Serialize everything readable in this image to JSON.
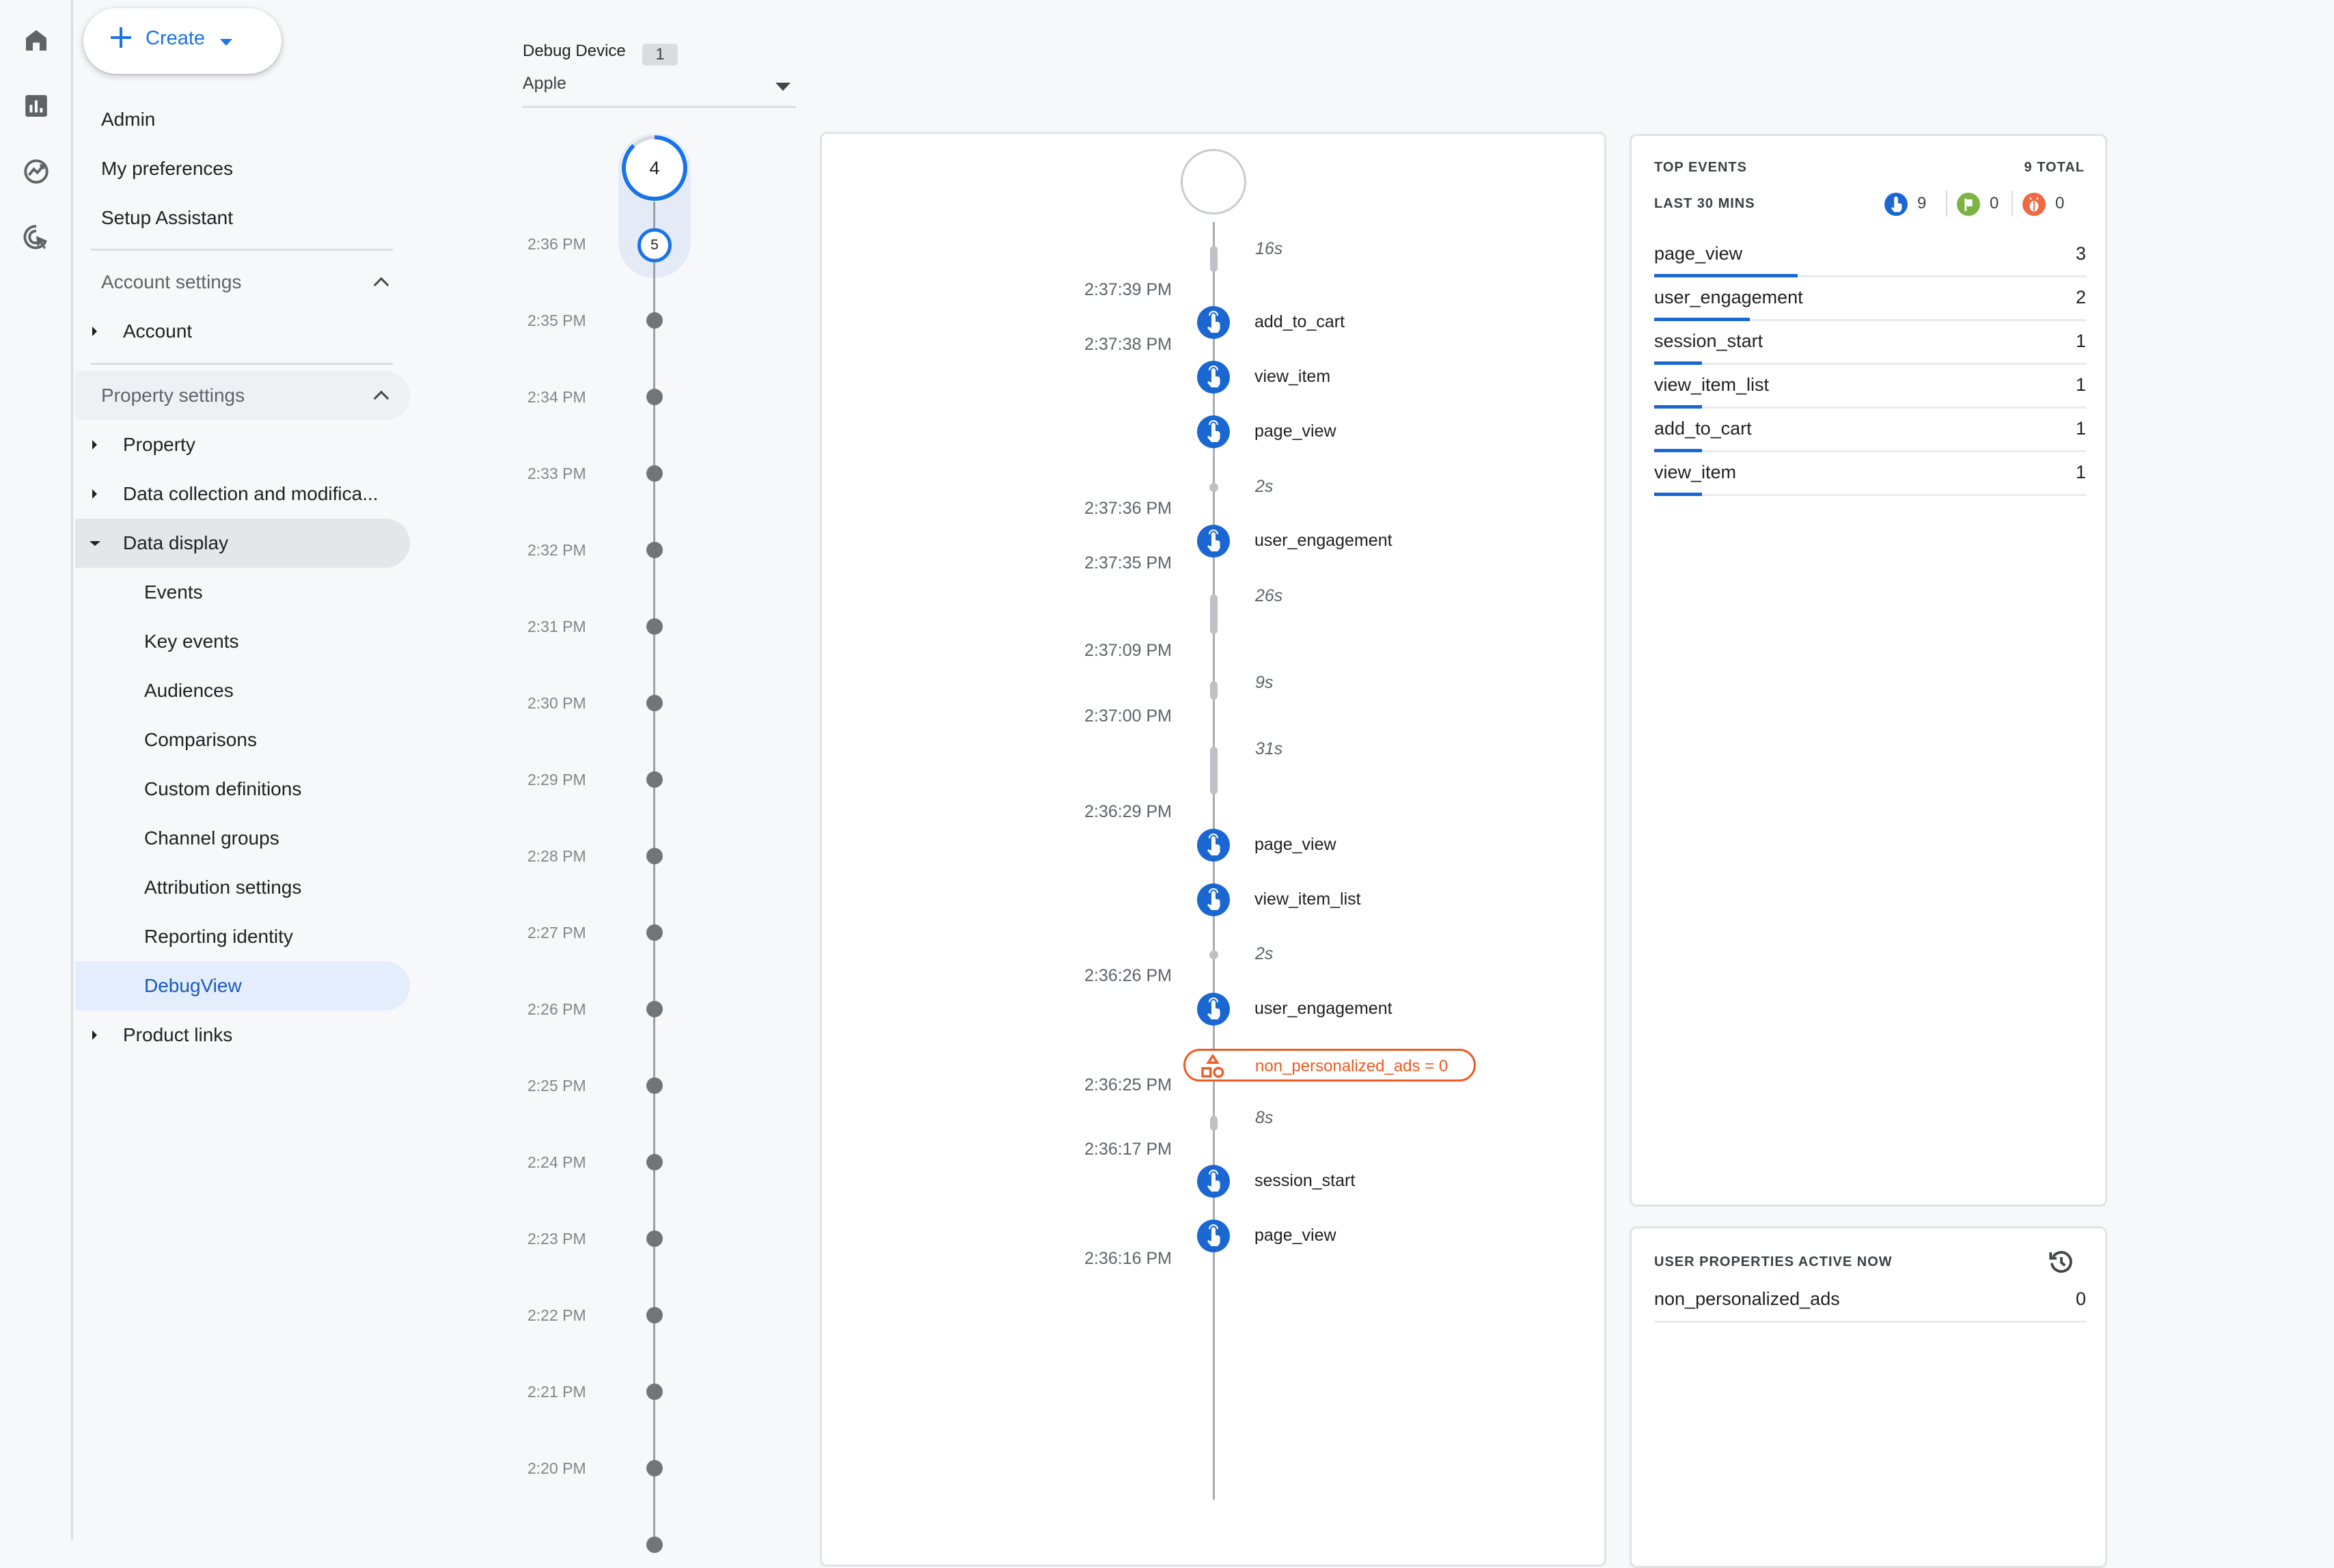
{
  "rail": {
    "icons": [
      "home-icon",
      "reports-icon",
      "explore-icon",
      "advertising-icon"
    ]
  },
  "nav": {
    "create_label": "Create",
    "top_items": [
      "Admin",
      "My preferences",
      "Setup Assistant"
    ],
    "account_settings": {
      "label": "Account settings",
      "items": [
        "Account"
      ]
    },
    "property_settings": {
      "label": "Property settings",
      "items": [
        "Property",
        "Data collection and modifica...",
        "Data display"
      ],
      "data_display_children": [
        "Events",
        "Key events",
        "Audiences",
        "Comparisons",
        "Custom definitions",
        "Channel groups",
        "Attribution settings",
        "Reporting identity",
        "DebugView"
      ],
      "active": "DebugView"
    },
    "product_links": "Product links"
  },
  "device": {
    "label": "Debug Device",
    "count": "1",
    "selected": "Apple"
  },
  "minutes": {
    "current_count": "4",
    "current_progress": 0.88,
    "selected_count": "5",
    "labels": [
      "2:36 PM",
      "2:35 PM",
      "2:34 PM",
      "2:33 PM",
      "2:32 PM",
      "2:31 PM",
      "2:30 PM",
      "2:29 PM",
      "2:28 PM",
      "2:27 PM",
      "2:26 PM",
      "2:25 PM",
      "2:24 PM",
      "2:23 PM",
      "2:22 PM",
      "2:21 PM",
      "2:20 PM"
    ]
  },
  "stream": {
    "gaps": [
      {
        "label": "16s"
      },
      {
        "label": "2s"
      },
      {
        "label": "26s"
      },
      {
        "label": "9s"
      },
      {
        "label": "31s"
      },
      {
        "label": "2s"
      },
      {
        "label": "8s"
      }
    ],
    "timestamps": [
      "2:37:39 PM",
      "2:37:38 PM",
      "2:37:36 PM",
      "2:37:35 PM",
      "2:37:09 PM",
      "2:37:00 PM",
      "2:36:29 PM",
      "2:36:26 PM",
      "2:36:25 PM",
      "2:36:17 PM",
      "2:36:16 PM"
    ],
    "events": [
      "add_to_cart",
      "view_item",
      "page_view",
      "user_engagement",
      "page_view",
      "view_item_list",
      "user_engagement",
      "session_start",
      "page_view"
    ],
    "user_property_change": "non_personalized_ads = 0",
    "colors": {
      "event": "#1a67d2",
      "user_property": "#f05a22"
    }
  },
  "top_events": {
    "title": "TOP EVENTS",
    "total": "9 TOTAL",
    "window": "LAST 30 MINS",
    "counts": {
      "events": "9",
      "key_events": "0",
      "errors": "0"
    },
    "rows": [
      {
        "name": "page_view",
        "value": "3",
        "share": 1.0
      },
      {
        "name": "user_engagement",
        "value": "2",
        "share": 0.667
      },
      {
        "name": "session_start",
        "value": "1",
        "share": 0.333
      },
      {
        "name": "view_item_list",
        "value": "1",
        "share": 0.333
      },
      {
        "name": "add_to_cart",
        "value": "1",
        "share": 0.333
      },
      {
        "name": "view_item",
        "value": "1",
        "share": 0.333
      }
    ]
  },
  "user_properties": {
    "title": "USER PROPERTIES ACTIVE NOW",
    "rows": [
      {
        "name": "non_personalized_ads",
        "value": "0"
      }
    ]
  }
}
